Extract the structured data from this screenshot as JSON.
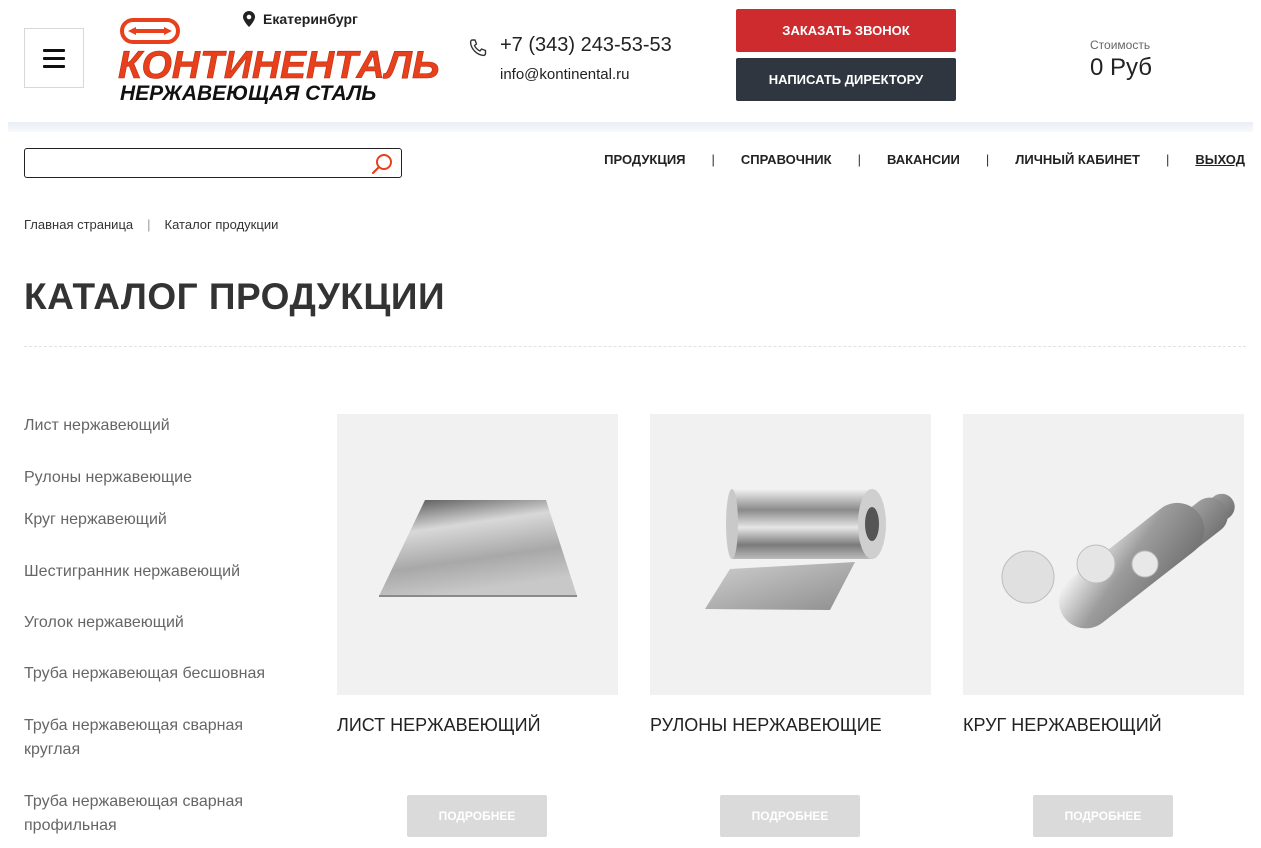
{
  "header": {
    "menu_icon": "hamburger-icon",
    "logo_top": "КОНТИНЕНТАЛЬ",
    "logo_bottom": "НЕРЖАВЕЮЩАЯ СТАЛЬ",
    "city": "Екатеринбург",
    "phone": "+7 (343) 243-53-53",
    "email": "info@kontinental.ru",
    "call_button": "ЗАКАЗАТЬ ЗВОНОК",
    "director_button": "НАПИСАТЬ ДИРЕКТОРУ",
    "cost_label": "Стоимость",
    "cost_value": "0 Руб",
    "colors": {
      "accent_red": "#cd2b2e",
      "dark": "#2f3640",
      "logo_orange": "#e8401c"
    }
  },
  "search": {
    "value": "",
    "placeholder": "",
    "icon": "search-icon"
  },
  "nav": {
    "items": [
      "ПРОДУКЦИЯ",
      "СПРАВОЧНИК",
      "ВАКАНСИИ",
      "ЛИЧНЫЙ КАБИНЕТ"
    ],
    "logout": "ВЫХОД",
    "separator": "|"
  },
  "breadcrumb": {
    "home": "Главная страница",
    "separator": "|",
    "current": "Каталог продукции"
  },
  "page": {
    "title": "КАТАЛОГ ПРОДУКЦИИ"
  },
  "sidebar": {
    "items": [
      "Лист нержавеющий",
      "Рулоны нержавеющие",
      "Круг нержавеющий",
      "Шестигранник нержавеющий",
      "Уголок нержавеющий",
      "Труба нержавеющая бесшовная",
      "Труба нержавеющая сварная круглая",
      "Труба нержавеющая сварная профильная"
    ]
  },
  "products": [
    {
      "title": "ЛИСТ НЕРЖАВЕЮЩИЙ",
      "button": "ПОДРОБНЕЕ",
      "image": "steel-sheet-image"
    },
    {
      "title": "РУЛОНЫ НЕРЖАВЕЮЩИЕ",
      "button": "ПОДРОБНЕЕ",
      "image": "steel-roll-image"
    },
    {
      "title": "КРУГ НЕРЖАВЕЮЩИЙ",
      "button": "ПОДРОБНЕЕ",
      "image": "steel-rods-image"
    }
  ]
}
